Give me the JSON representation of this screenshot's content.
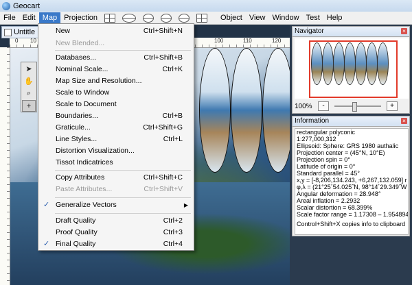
{
  "app": {
    "title": "Geocart"
  },
  "menubar": {
    "items": [
      "File",
      "Edit",
      "Map",
      "Projection"
    ],
    "items_right": [
      "Object",
      "View",
      "Window",
      "Test",
      "Help"
    ],
    "projection_icons": [
      "grid-projection-icon",
      "ellipse-projection-icon",
      "conic-projection-icon",
      "azimuthal-projection-icon",
      "globe-projection-icon",
      "polyhedral-projection-icon"
    ]
  },
  "document": {
    "tab_title": "Untitle",
    "ruler_labels": [
      "0",
      "10",
      "100",
      "110",
      "120"
    ]
  },
  "map_menu": {
    "items": [
      {
        "label": "New",
        "shortcut": "Ctrl+Shift+N",
        "enabled": true,
        "checked": false
      },
      {
        "label": "New Blended...",
        "shortcut": "",
        "enabled": false,
        "checked": false
      },
      {
        "label": "Databases...",
        "shortcut": "Ctrl+Shift+B",
        "enabled": true,
        "checked": false
      },
      {
        "label": "Nominal Scale...",
        "shortcut": "Ctrl+K",
        "enabled": true,
        "checked": false
      },
      {
        "label": "Map Size and Resolution...",
        "shortcut": "",
        "enabled": true,
        "checked": false
      },
      {
        "label": "Scale to Window",
        "shortcut": "",
        "enabled": true,
        "checked": false
      },
      {
        "label": "Scale to Document",
        "shortcut": "",
        "enabled": true,
        "checked": false
      },
      {
        "label": "Boundaries...",
        "shortcut": "Ctrl+B",
        "enabled": true,
        "checked": false
      },
      {
        "label": "Graticule...",
        "shortcut": "Ctrl+Shift+G",
        "enabled": true,
        "checked": false
      },
      {
        "label": "Line Styles...",
        "shortcut": "Ctrl+L",
        "enabled": true,
        "checked": false
      },
      {
        "label": "Distortion Visualization...",
        "shortcut": "",
        "enabled": true,
        "checked": false
      },
      {
        "label": "Tissot Indicatrices",
        "shortcut": "",
        "enabled": true,
        "checked": false
      },
      {
        "label": "Copy Attributes",
        "shortcut": "Ctrl+Shift+C",
        "enabled": true,
        "checked": false
      },
      {
        "label": "Paste Attributes...",
        "shortcut": "Ctrl+Shift+V",
        "enabled": false,
        "checked": false
      },
      {
        "label": "Generalize Vectors",
        "shortcut": "",
        "enabled": true,
        "checked": true,
        "submenu": true
      },
      {
        "label": "Draft Quality",
        "shortcut": "Ctrl+2",
        "enabled": true,
        "checked": false
      },
      {
        "label": "Proof Quality",
        "shortcut": "Ctrl+3",
        "enabled": true,
        "checked": false
      },
      {
        "label": "Final Quality",
        "shortcut": "Ctrl+4",
        "enabled": true,
        "checked": true
      }
    ]
  },
  "navigator": {
    "title": "Navigator",
    "zoom_label": "100%",
    "zoom_out": "-",
    "zoom_in": "+"
  },
  "information": {
    "title": "Information",
    "lines": [
      "rectangular polyconic",
      "1:277,000,312",
      "Ellipsoid: Sphere: GRS 1980 authalic",
      "Projection center = (45°N, 10°E)",
      "Projection spin = 0°",
      "Latitude of origin = 0°",
      "Standard parallel = 45°",
      "x,y = [-8,206,134.243, +6,267,132.059] r",
      "φ,λ = (21°25´54.025˝N, 98°14´29.349˝W",
      "Angular deformation = 28.948°",
      "Areal inflation = 2.2932",
      "Scalar distortion = 68.399%",
      "Scale factor range = 1.17308 – 1.954894",
      "Control+Shift+X copies info to clipboard"
    ]
  }
}
